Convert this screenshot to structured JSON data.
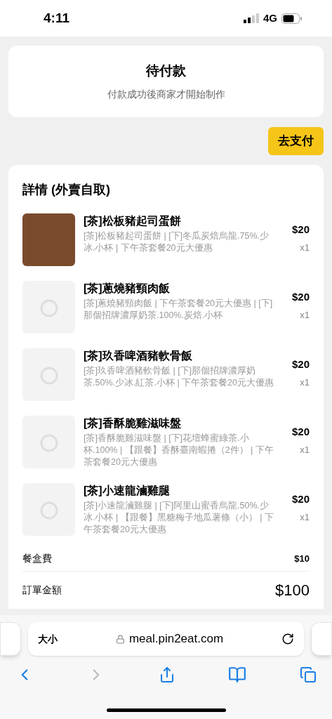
{
  "status_bar": {
    "time": "4:11",
    "network": "4G"
  },
  "status_card": {
    "title": "待付款",
    "subtitle": "付款成功後商家才開始制作"
  },
  "pay_button": "去支付",
  "details": {
    "title": "詳情 (外賣自取)",
    "items": [
      {
        "kind": "photo",
        "name": "[茶]松板豬起司蛋餅",
        "desc": "[茶]松板豬起司蛋餅 | [下]冬瓜炭焙烏龍.75%.少冰.小杯 | 下午茶套餐20元大優惠",
        "price": "$20",
        "qty": "x1"
      },
      {
        "kind": "placeholder",
        "name": "[茶]蔥燒豬頸肉飯",
        "desc": "[茶]蔥燒豬頸肉飯 | 下午茶套餐20元大優惠 | [下]那個招牌濃厚奶茶.100%.炭焙.小杯",
        "price": "$20",
        "qty": "x1"
      },
      {
        "kind": "placeholder",
        "name": "[茶]玖香啤酒豬軟骨飯",
        "desc": "[茶]玖香啤酒豬軟骨飯 | [下]那個招牌濃厚奶茶.50%.少冰.紅茶.小杯 | 下午茶套餐20元大優惠",
        "price": "$20",
        "qty": "x1"
      },
      {
        "kind": "placeholder",
        "name": "[茶]香酥脆雞滋味盤",
        "desc": "[茶]香酥脆雞滋味盤 | [下]花壇蜂蜜綠茶.小杯.100% | 【跟餐】香酥臺南蝦捲（2件） | 下午茶套餐20元大優惠",
        "price": "$20",
        "qty": "x1"
      },
      {
        "kind": "placeholder",
        "name": "[茶]小速龍滷雞腿",
        "desc": "[茶]小速龍滷雞腿 | [下]阿里山蜜香烏龍.50%.少冰.小杯 | 【跟餐】黑糖梅子地瓜薯條（小） | 下午茶套餐20元大優惠",
        "price": "$20",
        "qty": "x1"
      }
    ],
    "box_fee": {
      "label": "餐盒費",
      "value": "$10"
    },
    "order_total": {
      "label": "訂單金額",
      "value": "$100"
    }
  },
  "browser": {
    "text_size": "大小",
    "url": "meal.pin2eat.com"
  }
}
